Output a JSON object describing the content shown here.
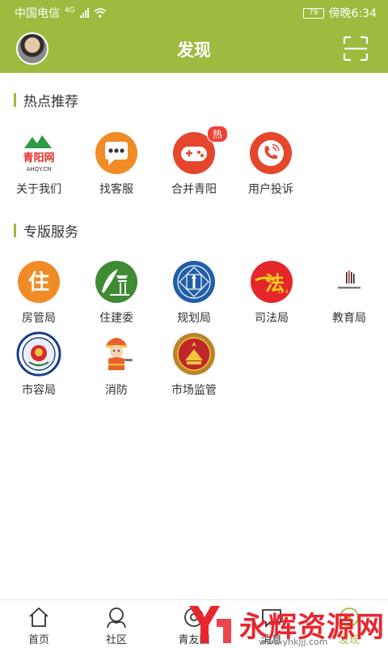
{
  "status_bar": {
    "carrier": "中国电信",
    "network": "4G",
    "battery": "79",
    "time": "傍晚6:34"
  },
  "header": {
    "title": "发现"
  },
  "sections": [
    {
      "title": "热点推荐",
      "items": [
        {
          "label": "关于我们",
          "icon": "qingyang-logo-icon",
          "logo_text": "青阳网",
          "logo_sub": "AHQY.CN"
        },
        {
          "label": "找客服",
          "icon": "chat-bubble-icon"
        },
        {
          "label": "合并青阳",
          "icon": "gamepad-icon",
          "badge": "热"
        },
        {
          "label": "用户投诉",
          "icon": "phone-call-icon"
        }
      ]
    },
    {
      "title": "专版服务",
      "items": [
        {
          "label": "房管局",
          "icon": "housing-bureau-icon",
          "glyph": "住"
        },
        {
          "label": "住建委",
          "icon": "construction-committee-icon"
        },
        {
          "label": "规划局",
          "icon": "planning-bureau-icon"
        },
        {
          "label": "司法局",
          "icon": "justice-bureau-icon",
          "glyph": "法"
        },
        {
          "label": "教育局",
          "icon": "education-bureau-icon"
        },
        {
          "label": "市容局",
          "icon": "city-appearance-emblem-icon"
        },
        {
          "label": "消防",
          "icon": "firefighter-mascot-icon"
        },
        {
          "label": "市场监管",
          "icon": "market-supervision-emblem-icon"
        }
      ]
    }
  ],
  "tabs": [
    {
      "label": "首页",
      "icon": "home-icon",
      "active": false
    },
    {
      "label": "社区",
      "icon": "community-icon",
      "active": false
    },
    {
      "label": "青友圈",
      "icon": "friends-circle-icon",
      "active": false
    },
    {
      "label": "消息",
      "icon": "message-icon",
      "active": false
    },
    {
      "label": "发现",
      "icon": "discover-icon",
      "active": true
    }
  ],
  "watermark": {
    "text": "永辉资源网",
    "url": "www.yhkjjj.com"
  },
  "colors": {
    "brand": "#9cbb3f",
    "badge": "#ef4136",
    "orange": "#f08b26",
    "red": "#e5462c",
    "blue": "#1f5ea8"
  }
}
